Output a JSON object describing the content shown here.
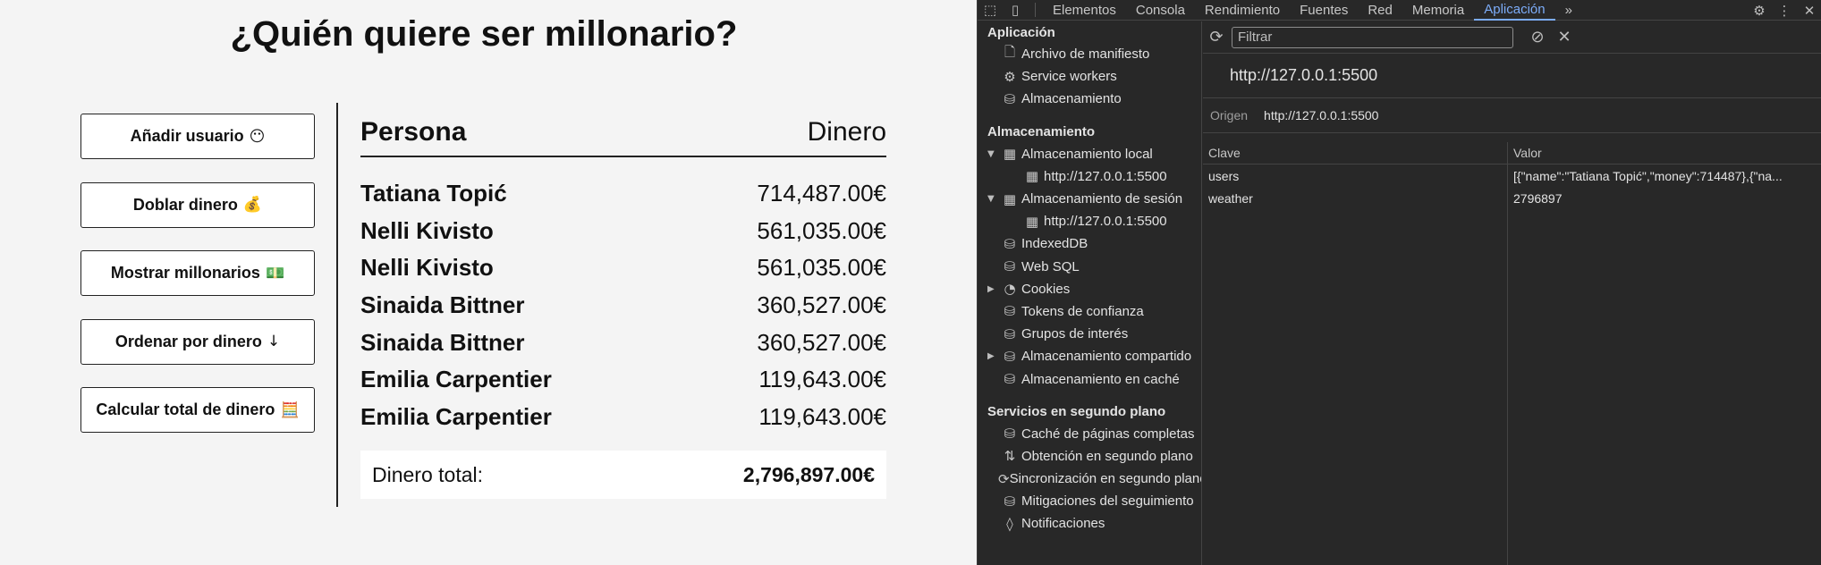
{
  "app": {
    "title": "¿Quién quiere ser millonario?",
    "buttons": [
      {
        "label": "Añadir usuario",
        "emoji": "😶"
      },
      {
        "label": "Doblar dinero",
        "emoji": "💰"
      },
      {
        "label": "Mostrar millonarios",
        "emoji": "💵"
      },
      {
        "label": "Ordenar por dinero",
        "emoji": "↓"
      },
      {
        "label": "Calcular total de dinero",
        "emoji": "🧮"
      }
    ],
    "table": {
      "header_person": "Persona",
      "header_money": "Dinero",
      "rows": [
        {
          "name": "Tatiana Topić",
          "money": "714,487.00€"
        },
        {
          "name": "Nelli Kivisto",
          "money": "561,035.00€"
        },
        {
          "name": "Nelli Kivisto",
          "money": "561,035.00€"
        },
        {
          "name": "Sinaida Bittner",
          "money": "360,527.00€"
        },
        {
          "name": "Sinaida Bittner",
          "money": "360,527.00€"
        },
        {
          "name": "Emilia Carpentier",
          "money": "119,643.00€"
        },
        {
          "name": "Emilia Carpentier",
          "money": "119,643.00€"
        }
      ],
      "total_label": "Dinero total:",
      "total_value": "2,796,897.00€"
    }
  },
  "devtools": {
    "tabs": [
      "Elementos",
      "Consola",
      "Rendimiento",
      "Fuentes",
      "Red",
      "Memoria",
      "Aplicación"
    ],
    "active_tab": "Aplicación",
    "more_tabs": "»",
    "sidebar": {
      "section_app": "Aplicación",
      "app_items": [
        "Archivo de manifiesto",
        "Service workers",
        "Almacenamiento"
      ],
      "section_storage": "Almacenamiento",
      "storage_items": {
        "local": "Almacenamiento local",
        "local_origin": "http://127.0.0.1:5500",
        "session": "Almacenamiento de sesión",
        "session_origin": "http://127.0.0.1:5500",
        "indexeddb": "IndexedDB",
        "websql": "Web SQL",
        "cookies": "Cookies",
        "trust_tokens": "Tokens de confianza",
        "interest_groups": "Grupos de interés",
        "shared_storage": "Almacenamiento compartido",
        "cache_storage": "Almacenamiento en caché"
      },
      "section_bg": "Servicios en segundo plano",
      "bg_items": [
        "Caché de páginas completas",
        "Obtención en segundo plano",
        "Sincronización en segundo plano",
        "Mitigaciones del seguimiento",
        "Notificaciones"
      ]
    },
    "panel": {
      "filter_placeholder": "Filtrar",
      "origin_title": "http://127.0.0.1:5500",
      "origin_label": "Origen",
      "origin_value": "http://127.0.0.1:5500",
      "col_key": "Clave",
      "col_value": "Valor",
      "entries": [
        {
          "key": "users",
          "value": "[{\"name\":\"Tatiana Topić\",\"money\":714487},{\"na..."
        },
        {
          "key": "weather",
          "value": "2796897"
        }
      ]
    }
  }
}
